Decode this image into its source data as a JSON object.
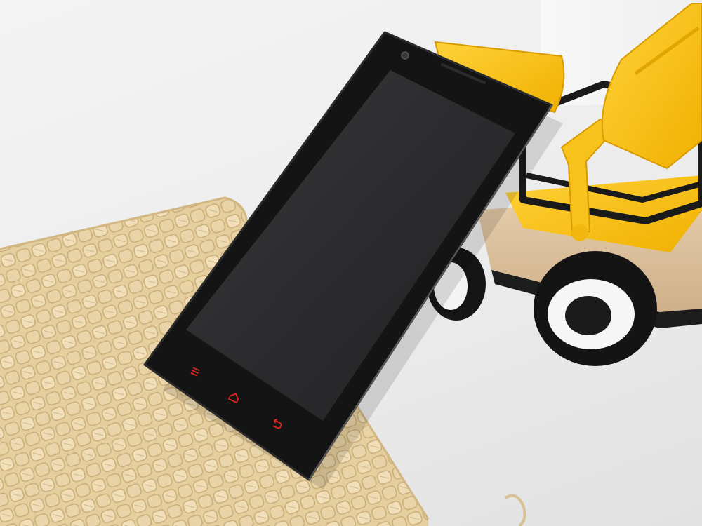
{
  "scene": {
    "description_label": "",
    "colors": {
      "background": "#eeeeee",
      "phone_body": "#151515",
      "phone_screen": "#2b2b2d",
      "nav_keys": "#e0251b",
      "toy_yellow": "#f5c015",
      "toy_wood": "#dcc2a2",
      "wicker": "#e8d3a6"
    },
    "objects": [
      {
        "id": "wicker-mat",
        "kind": "woven wicker coaster"
      },
      {
        "id": "toy-loader",
        "kind": "yellow toy front loader with wooden base and black/white wheels"
      },
      {
        "id": "smartphone",
        "kind": "black smartphone with blank screen and red capacitive keys"
      }
    ],
    "phone": {
      "nav_icons": [
        "menu-icon",
        "home-icon",
        "back-icon"
      ]
    }
  }
}
